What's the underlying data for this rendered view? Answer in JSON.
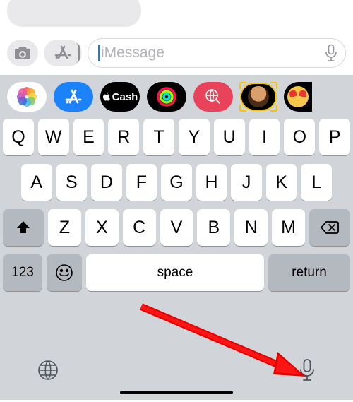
{
  "input": {
    "placeholder": "iMessage"
  },
  "appStrip": {
    "cash_label": "Cash"
  },
  "keyboard": {
    "row1": [
      "Q",
      "W",
      "E",
      "R",
      "T",
      "Y",
      "U",
      "I",
      "O",
      "P"
    ],
    "row2": [
      "A",
      "S",
      "D",
      "F",
      "G",
      "H",
      "J",
      "K",
      "L"
    ],
    "row3": [
      "Z",
      "X",
      "C",
      "V",
      "B",
      "N",
      "M"
    ],
    "numeric": "123",
    "space": "space",
    "return": "return"
  }
}
